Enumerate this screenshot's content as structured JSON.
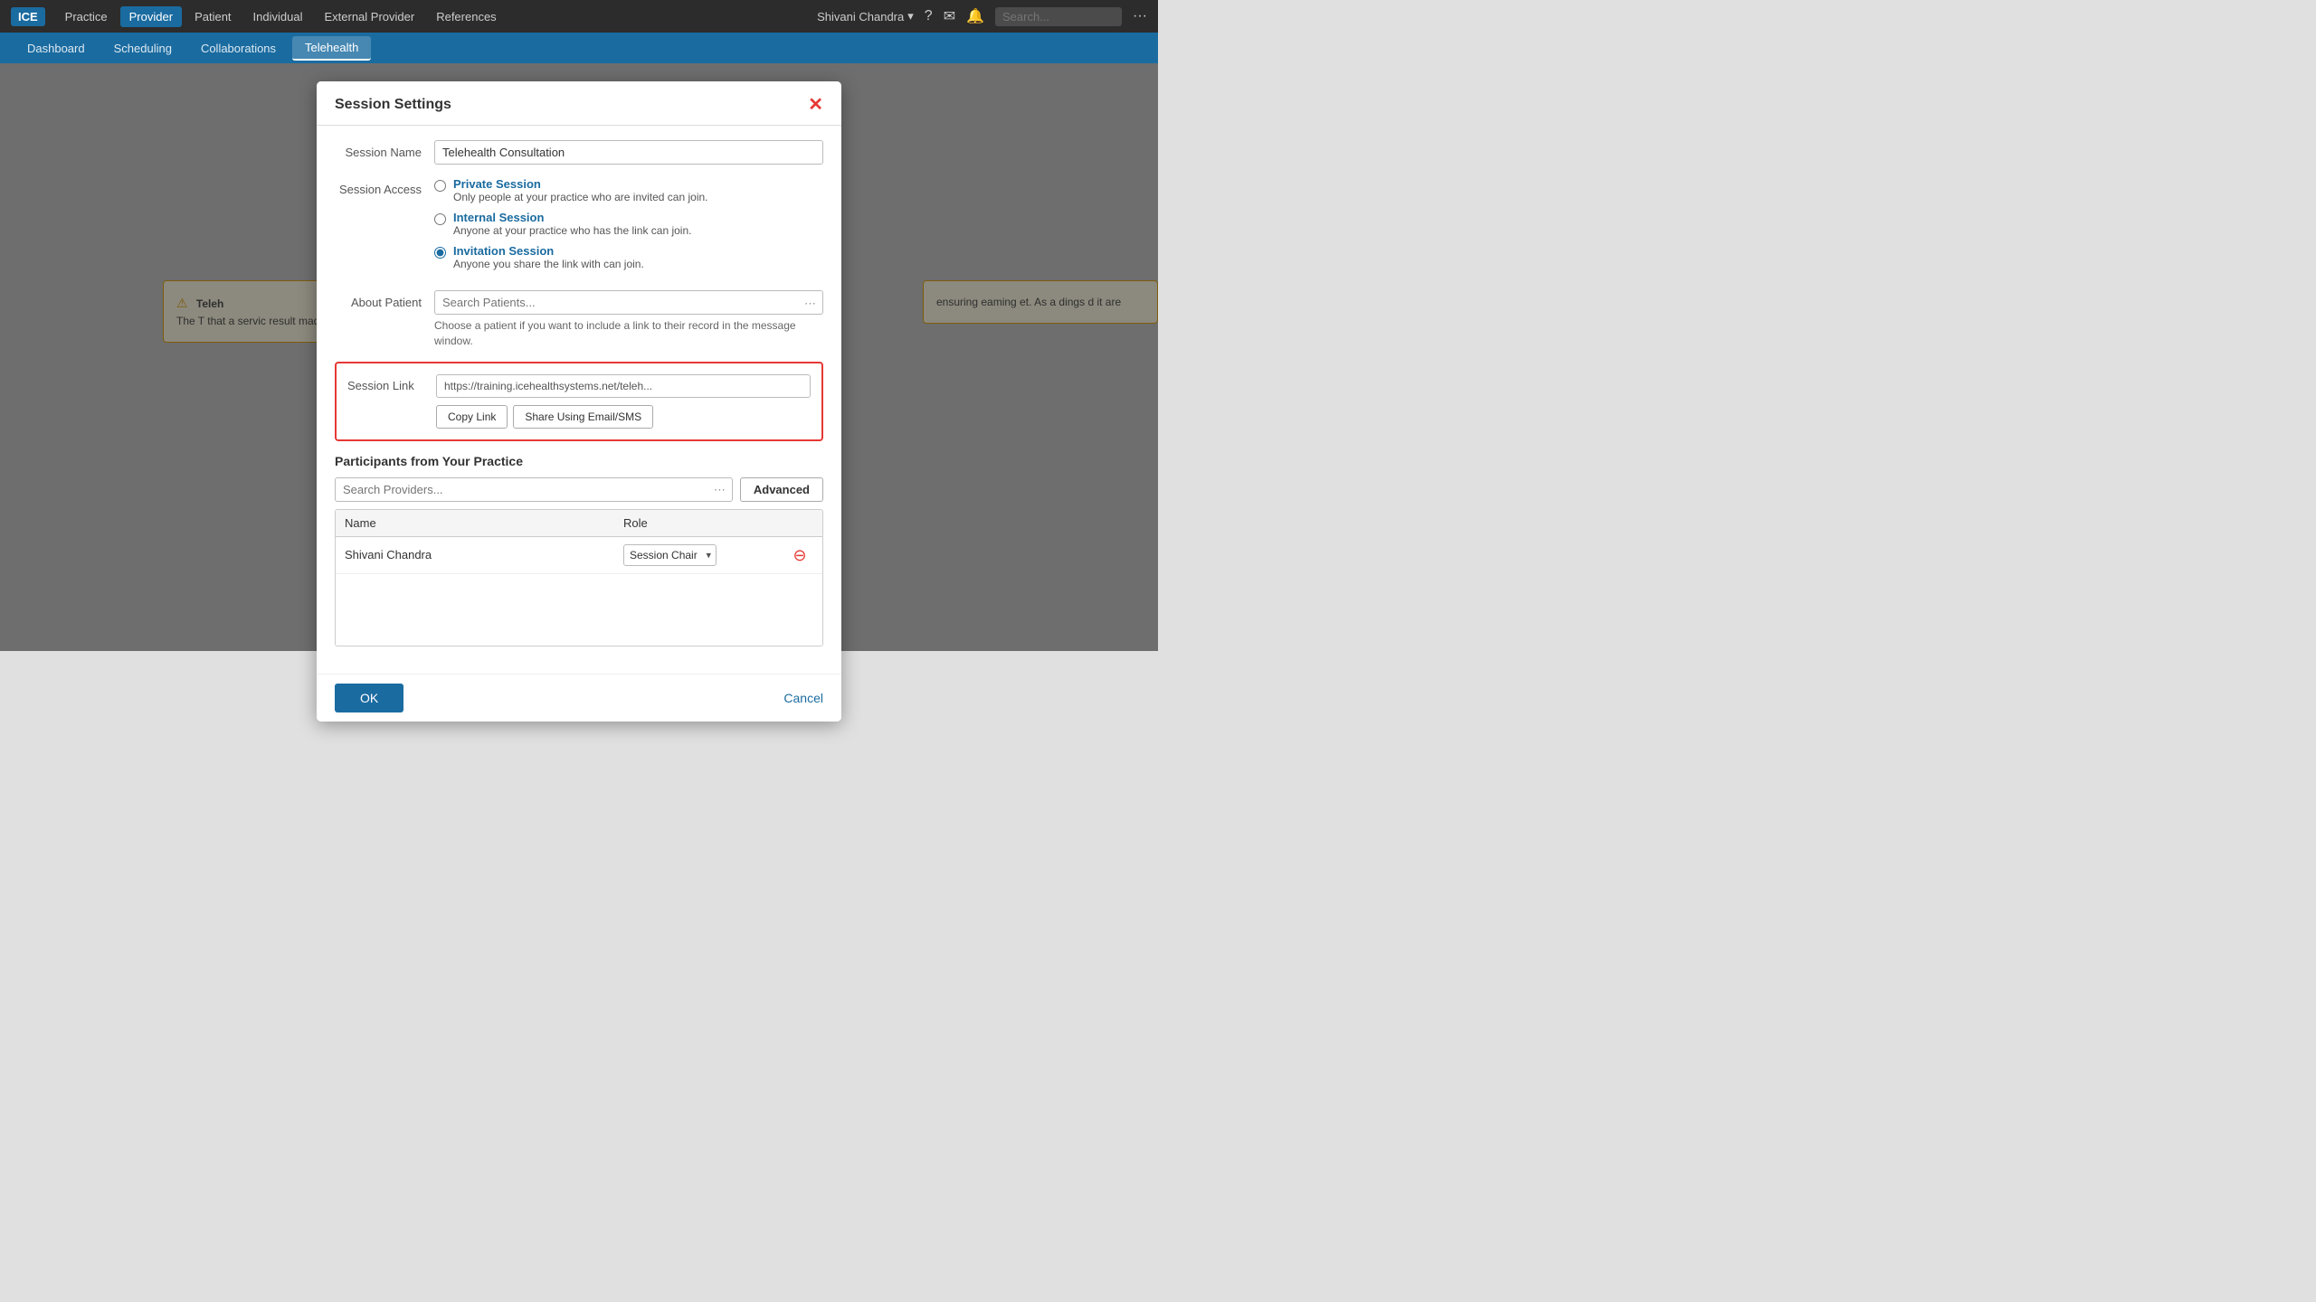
{
  "app": {
    "logo": "ICE",
    "top_nav": {
      "items": [
        {
          "label": "Practice",
          "active": false
        },
        {
          "label": "Provider",
          "active": true
        },
        {
          "label": "Patient",
          "active": false
        },
        {
          "label": "Individual",
          "active": false
        },
        {
          "label": "External Provider",
          "active": false
        },
        {
          "label": "References",
          "active": false
        }
      ],
      "user": "Shivani Chandra",
      "search_placeholder": "Search..."
    },
    "sec_nav": {
      "items": [
        {
          "label": "Dashboard",
          "active": false
        },
        {
          "label": "Scheduling",
          "active": false
        },
        {
          "label": "Collaborations",
          "active": false
        },
        {
          "label": "Telehealth",
          "active": true
        }
      ]
    }
  },
  "dialog": {
    "title": "Session Settings",
    "session_name_label": "Session Name",
    "session_name_value": "Telehealth Consultation",
    "session_access_label": "Session Access",
    "access_options": [
      {
        "id": "private",
        "label": "Private Session",
        "description": "Only people at your practice who are invited can join.",
        "selected": false
      },
      {
        "id": "internal",
        "label": "Internal Session",
        "description": "Anyone at your practice who has the link can join.",
        "selected": false
      },
      {
        "id": "invitation",
        "label": "Invitation Session",
        "description": "Anyone you share the link with can join.",
        "selected": true
      }
    ],
    "about_patient_label": "About Patient",
    "patient_search_placeholder": "Search Patients...",
    "patient_help_text": "Choose a patient if you want to include a link to their record in the message window.",
    "session_link_label": "Session Link",
    "session_link_value": "https://training.icehealthsystems.net/teleh...",
    "copy_link_button": "Copy Link",
    "share_button": "Share Using Email/SMS",
    "participants_title": "Participants from Your Practice",
    "providers_search_placeholder": "Search Providers...",
    "advanced_button": "Advanced",
    "table": {
      "col_name": "Name",
      "col_role": "Role",
      "rows": [
        {
          "name": "Shivani Chandra",
          "role": "Session Chair"
        }
      ]
    },
    "ok_button": "OK",
    "cancel_button": "Cancel"
  },
  "warning": {
    "icon": "⚠",
    "title": "Teleh",
    "text": "The T that a servic result made shoul prope"
  }
}
